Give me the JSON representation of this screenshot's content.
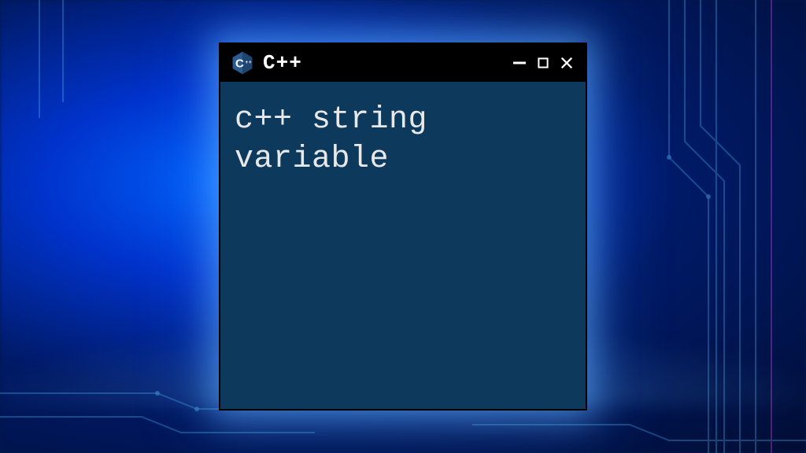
{
  "window": {
    "title": "C++",
    "logo_letter": "C",
    "controls": {
      "minimize": "minimize",
      "maximize": "maximize",
      "close": "close"
    }
  },
  "content": {
    "text": "c++ string variable"
  },
  "colors": {
    "window_bg": "#0d3a5c",
    "titlebar_bg": "#000000",
    "text": "#e8e8e8",
    "accent_glow": "#5ab4ff"
  }
}
